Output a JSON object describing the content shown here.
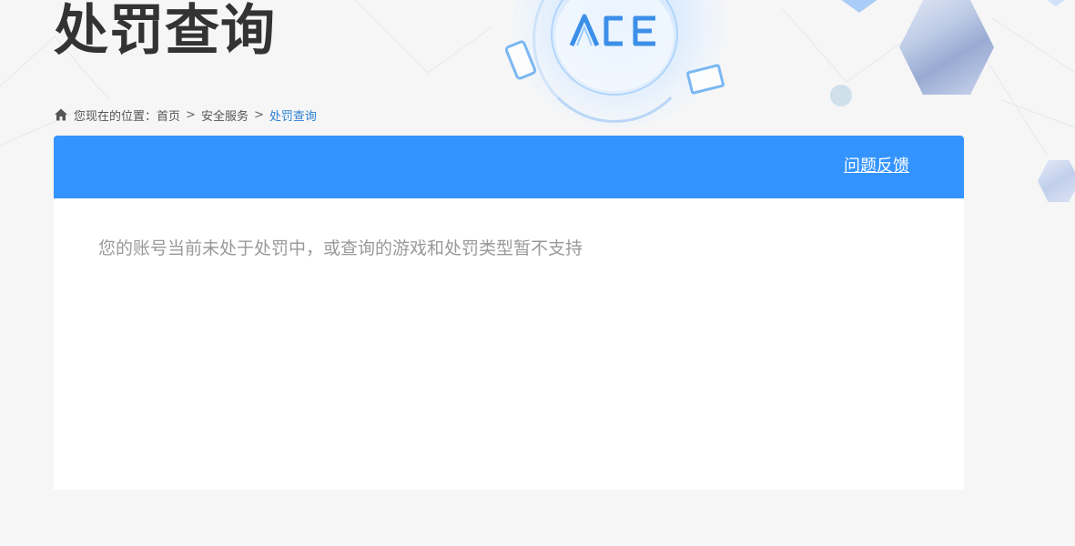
{
  "page": {
    "title": "处罚查询"
  },
  "breadcrumb": {
    "prefix": "您现在的位置：",
    "items": [
      "首页",
      "安全服务",
      "处罚查询"
    ],
    "separator": ">"
  },
  "panel": {
    "feedback_label": "问题反馈",
    "message": "您的账号当前未处于处罚中，或查询的游戏和处罚类型暂不支持"
  },
  "colors": {
    "accent": "#3494ff",
    "title": "#333333",
    "breadcrumb_current": "#2b7fd4",
    "message": "#999999",
    "background": "#f6f6f6"
  },
  "icons": {
    "home": "home-icon",
    "phone": "game-phone-icon",
    "monitor": "game-monitor-icon",
    "logo": "ace-logo"
  }
}
